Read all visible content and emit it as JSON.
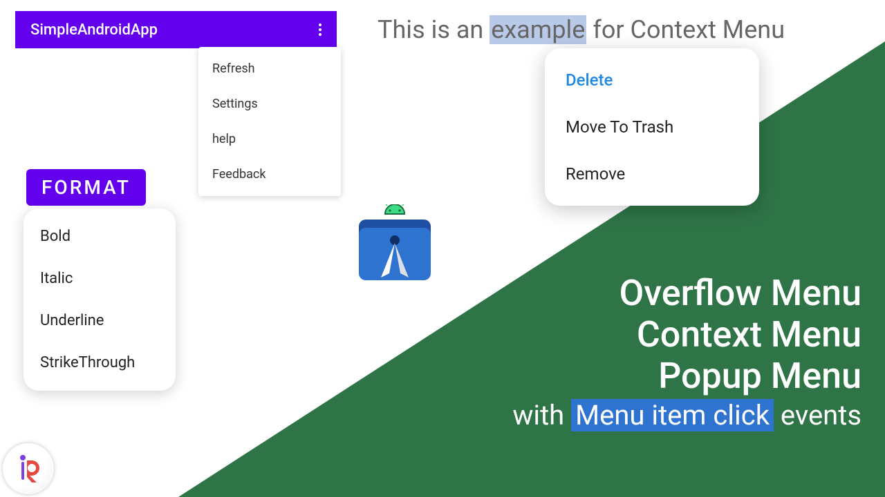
{
  "appbar": {
    "title": "SimpleAndroidApp"
  },
  "overflow_menu": {
    "items": [
      "Refresh",
      "Settings",
      "help",
      "Feedback"
    ]
  },
  "format_button": {
    "label": "FORMAT"
  },
  "popup_menu": {
    "items": [
      "Bold",
      "Italic",
      "Underline",
      "StrikeThrough"
    ]
  },
  "example_line": {
    "before": "This is an ",
    "selected": "example",
    "after": " for Context Menu"
  },
  "context_menu": {
    "items": [
      {
        "label": "Delete",
        "accent": true
      },
      {
        "label": "Move To Trash",
        "accent": false
      },
      {
        "label": "Remove",
        "accent": false
      }
    ]
  },
  "titles": {
    "line1": "Overflow Menu",
    "line2": "Context Menu",
    "line3": "Popup Menu",
    "sub_before": "with ",
    "sub_highlight": "Menu item click",
    "sub_after": " events"
  },
  "colors": {
    "green": "#2e7447",
    "purple": "#6200ee",
    "logo_blue": "#2f73d1",
    "highlight_blue": "#2f73d1"
  }
}
